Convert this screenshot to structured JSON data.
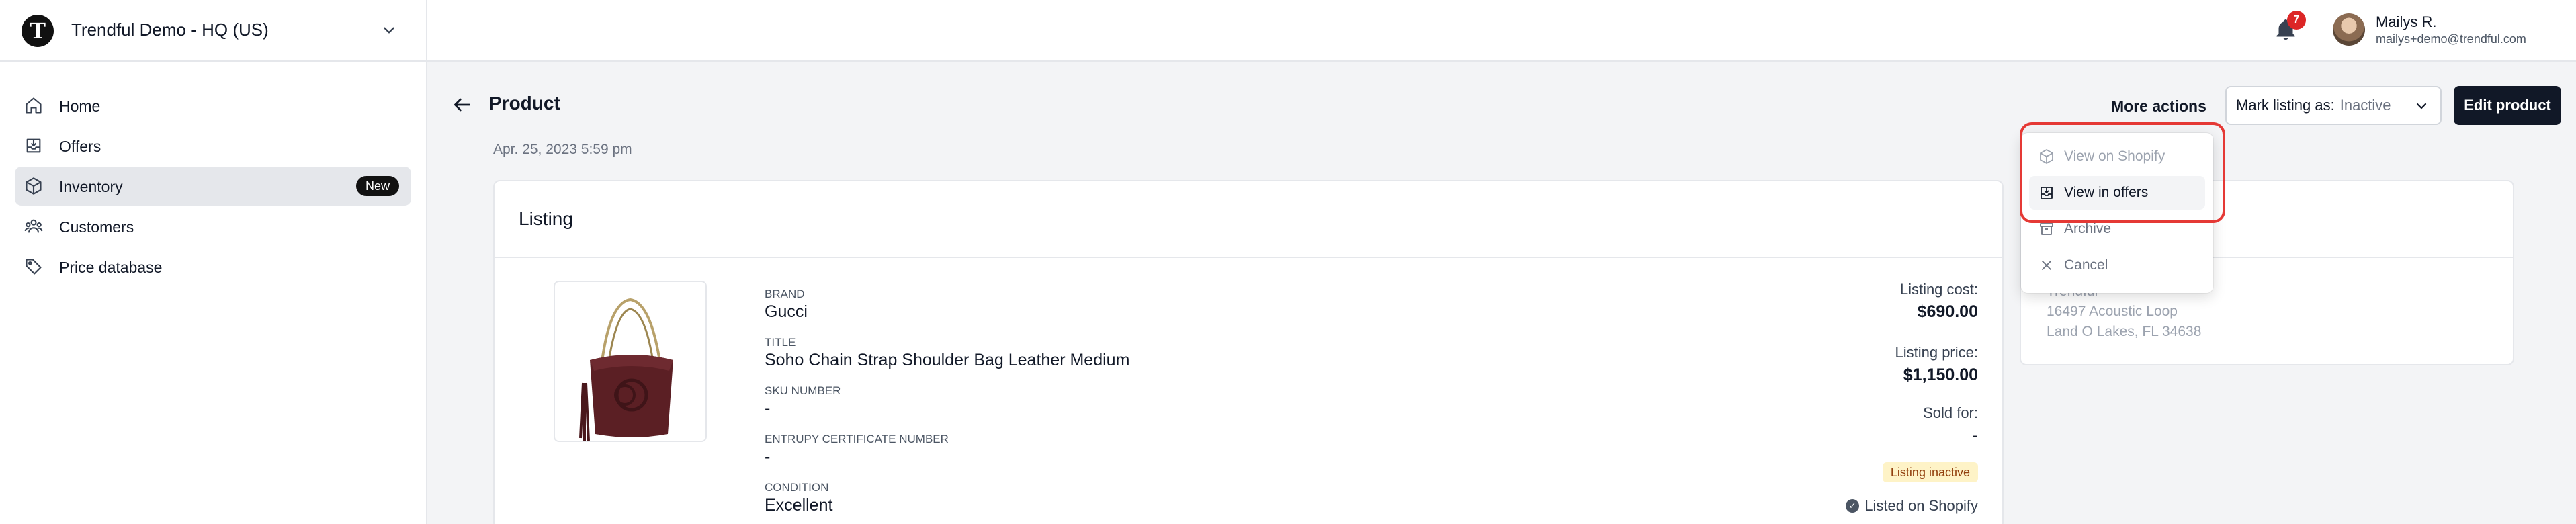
{
  "org": {
    "logo_letter": "T",
    "name": "Trendful Demo - HQ (US)"
  },
  "header": {
    "notification_count": "7",
    "user_name": "Mailys R.",
    "user_email": "mailys+demo@trendful.com"
  },
  "sidebar": {
    "items": [
      {
        "label": "Home",
        "icon": "home-icon"
      },
      {
        "label": "Offers",
        "icon": "inbox-icon"
      },
      {
        "label": "Inventory",
        "icon": "box-icon",
        "badge": "New",
        "active": true
      },
      {
        "label": "Customers",
        "icon": "users-icon"
      },
      {
        "label": "Price database",
        "icon": "tag-icon"
      }
    ]
  },
  "page": {
    "title": "Product",
    "date": "Apr. 25, 2023 5:59 pm",
    "more_actions": "More actions",
    "mark_listing_label": "Mark listing as:",
    "mark_listing_value": "Inactive",
    "edit_button": "Edit product"
  },
  "menu": {
    "items": [
      {
        "label": "View on Shopify",
        "icon": "cube-icon",
        "disabled": true
      },
      {
        "label": "View in offers",
        "icon": "inbox-icon",
        "hover": true
      },
      {
        "label": "Archive",
        "icon": "archive-icon"
      },
      {
        "label": "Cancel",
        "icon": "close-icon"
      }
    ]
  },
  "listing": {
    "title": "Listing",
    "fields": [
      {
        "label": "BRAND",
        "value": "Gucci"
      },
      {
        "label": "TITLE",
        "value": "Soho Chain Strap Shoulder Bag Leather Medium"
      },
      {
        "label": "SKU NUMBER",
        "value": "-"
      },
      {
        "label": "ENTRUPY CERTIFICATE NUMBER",
        "value": "-"
      },
      {
        "label": "CONDITION",
        "value": "Excellent"
      }
    ],
    "listing_cost_label": "Listing cost:",
    "listing_cost": "$690.00",
    "listing_price_label": "Listing price:",
    "listing_price": "$1,150.00",
    "sold_for_label": "Sold for:",
    "sold_for": "-",
    "status": "Listing inactive",
    "listed_on": "Listed on Shopify"
  },
  "location": {
    "name": "Trendful",
    "address1": "16497 Acoustic Loop",
    "address2": "Land O Lakes, FL 34638"
  },
  "colors": {
    "accent_dark": "#111827",
    "highlight_red": "#e53935",
    "badge_red": "#dc2626",
    "pill_bg": "#fef3c7"
  }
}
